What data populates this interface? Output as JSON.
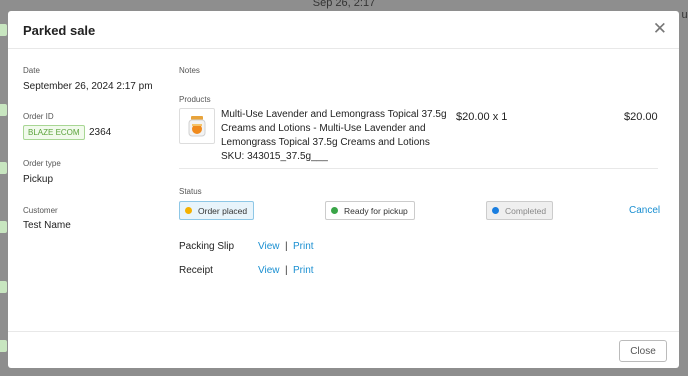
{
  "background": {
    "date_text": "Sep 26, 2:17",
    "right_text": "ul"
  },
  "modal": {
    "title": "Parked sale",
    "close_icon": "close-icon",
    "date_label": "Date",
    "date_value": "September 26, 2024 2:17 pm",
    "order_id_label": "Order ID",
    "source_badge": "BLAZE ECOM",
    "order_id_value": "2364",
    "order_type_label": "Order type",
    "order_type_value": "Pickup",
    "customer_label": "Customer",
    "customer_value": "Test Name",
    "notes_label": "Notes",
    "products_label": "Products",
    "product": {
      "name": "Multi-Use Lavender and Lemongrass Topical 37.5g Creams and Lotions - Multi-Use Lavender and Lemongrass Topical 37.5g Creams and Lotions",
      "sku": "SKU: 343015_37.5g___",
      "price_qty": "$20.00 x 1",
      "total": "$20.00"
    },
    "status_label": "Status",
    "statuses": [
      {
        "label": "Order placed",
        "dot_color": "#f5b100",
        "state": "active"
      },
      {
        "label": "Ready for pickup",
        "dot_color": "#3aa548",
        "state": "normal"
      },
      {
        "label": "Completed",
        "dot_color": "#1a7ee0",
        "state": "disabled"
      }
    ],
    "cancel_label": "Cancel",
    "packing_slip_label": "Packing Slip",
    "receipt_label": "Receipt",
    "view_label": "View",
    "print_label": "Print",
    "separator": "|",
    "close_button_label": "Close"
  },
  "colors": {
    "link": "#1a8fd1",
    "badge_green": "#5aa23a"
  }
}
